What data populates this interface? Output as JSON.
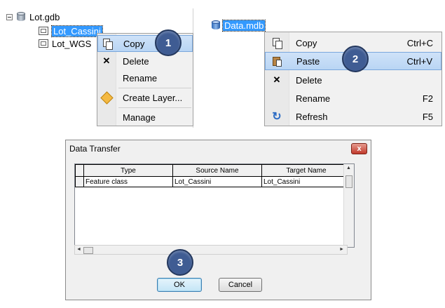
{
  "tree": {
    "root": "Lot.gdb",
    "items": [
      "Lot_Cassini",
      "Lot_WGS"
    ]
  },
  "menu1": {
    "items": [
      "Copy",
      "Delete",
      "Rename",
      "Create Layer...",
      "Manage"
    ]
  },
  "target": {
    "label": "Data.mdb"
  },
  "menu2": {
    "items": [
      {
        "label": "Copy",
        "shortcut": "Ctrl+C"
      },
      {
        "label": "Paste",
        "shortcut": "Ctrl+V"
      },
      {
        "label": "Delete",
        "shortcut": ""
      },
      {
        "label": "Rename",
        "shortcut": "F2"
      },
      {
        "label": "Refresh",
        "shortcut": "F5"
      }
    ]
  },
  "badges": [
    "1",
    "2",
    "3"
  ],
  "dialog": {
    "title": "Data Transfer",
    "close": "x",
    "columns": [
      "Type",
      "Source Name",
      "Target Name"
    ],
    "rows": [
      [
        "Feature class",
        "Lot_Cassini",
        "Lot_Cassini"
      ]
    ],
    "ok": "OK",
    "cancel": "Cancel"
  },
  "colors": {
    "selection": "#3399ff",
    "badge": "#3f5c93",
    "highlight": "#cfe2f8"
  },
  "icons": {
    "copy": "copy-icon",
    "paste": "paste-icon",
    "delete": "x-icon",
    "create_layer": "diamond-icon",
    "refresh": "refresh-icon",
    "database": "database-icon",
    "feature_class": "feature-class-icon"
  }
}
